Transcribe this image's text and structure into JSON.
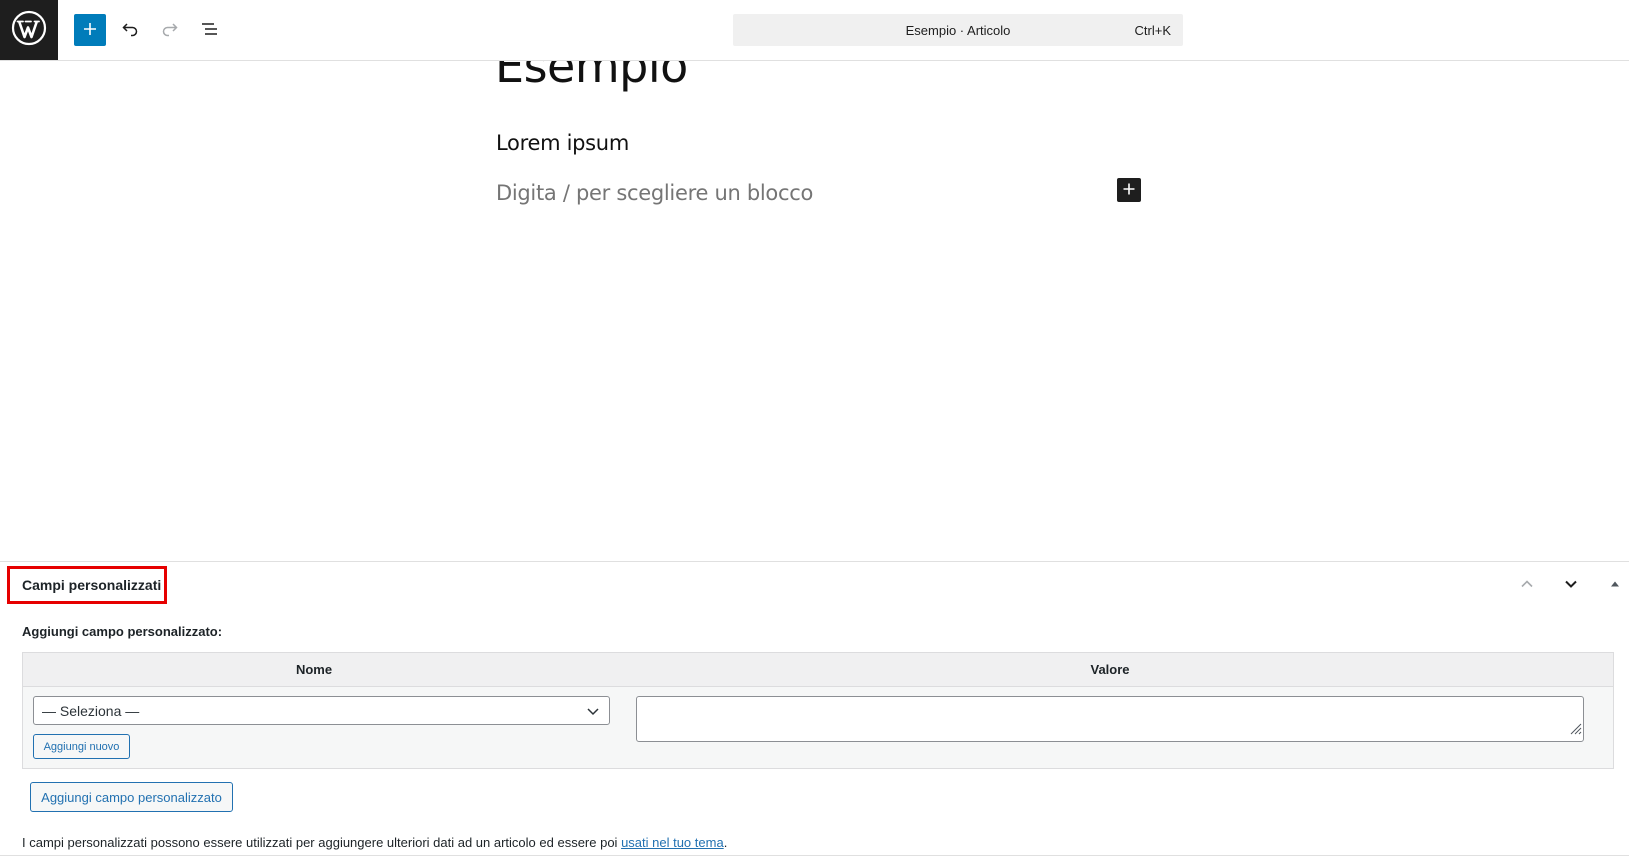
{
  "header": {
    "logo_icon": "wordpress-logo-icon",
    "inserter_icon": "plus-icon",
    "undo_icon": "undo-icon",
    "redo_icon": "redo-icon",
    "list_view_icon": "list-view-icon",
    "command_bar": {
      "title": "Esempio · Articolo",
      "shortcut": "Ctrl+K"
    },
    "accent_color": "#007cba"
  },
  "editor": {
    "post_title": "Esempio",
    "paragraph": "Lorem ipsum",
    "block_placeholder": "Digita / per scegliere un blocco",
    "block_inserter_icon": "plus-icon"
  },
  "metabox": {
    "title": "Campi personalizzati",
    "highlight_color": "#e60000",
    "move_up_icon": "chevron-up-icon",
    "move_down_icon": "chevron-down-icon",
    "toggle_icon": "triangle-up-icon",
    "add_label": "Aggiungi campo personalizzato:",
    "table": {
      "col_name": "Nome",
      "col_value": "Valore",
      "select_value": "— Seleziona —",
      "add_new_label": "Aggiungi nuovo",
      "value_text": ""
    },
    "add_field_button": "Aggiungi campo personalizzato",
    "help_text_before": "I campi personalizzati possono essere utilizzati per aggiungere ulteriori dati ad un articolo ed essere poi ",
    "help_link": "usati nel tuo tema",
    "help_text_after": ".",
    "link_color": "#2271b1"
  }
}
